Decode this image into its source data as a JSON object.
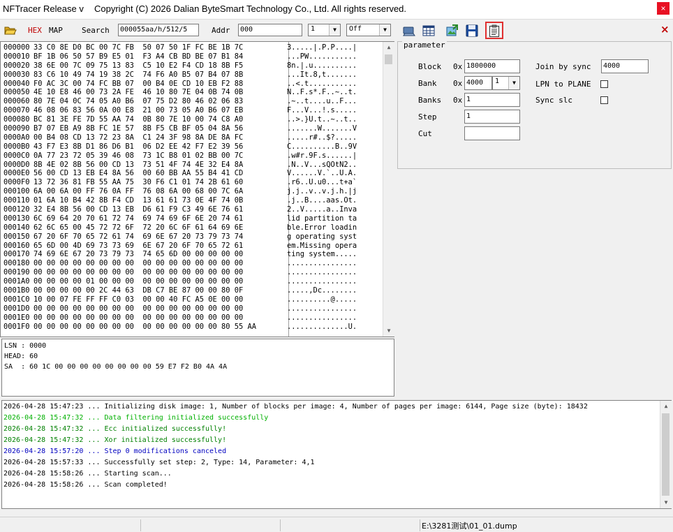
{
  "window": {
    "title": "NFTracer Release v",
    "copyright": "Copyright (C) 2026 Dalian ByteSmart Technology Co., Ltd. All rights reserved.",
    "close_label": "×"
  },
  "toolbar": {
    "hex_label": "HEX",
    "map_label": "MAP",
    "search_label": "Search",
    "search_value": "000055aa/h/512/5",
    "addr_label": "Addr",
    "addr_value": "000",
    "count_value": "1",
    "mode_value": "Off"
  },
  "hex_rows": [
    {
      "addr": "000000",
      "hex": "33 C0 8E D0 BC 00 7C FB  50 07 50 1F FC BE 1B 7C",
      "ascii": "3.....|.P.P....|"
    },
    {
      "addr": "000010",
      "hex": "BF 1B 06 50 57 B9 E5 01  F3 A4 CB BD BE 07 B1 84",
      "ascii": "...PW..........."
    },
    {
      "addr": "000020",
      "hex": "38 6E 00 7C 09 75 13 83  C5 10 E2 F4 CD 18 8B F5",
      "ascii": "8n.|.u.........."
    },
    {
      "addr": "000030",
      "hex": "83 C6 10 49 74 19 38 2C  74 F6 A0 B5 07 B4 07 8B",
      "ascii": "...It.8,t......."
    },
    {
      "addr": "000040",
      "hex": "F0 AC 3C 00 74 FC BB 07  00 B4 0E CD 10 EB F2 88",
      "ascii": "..<.t..........."
    },
    {
      "addr": "000050",
      "hex": "4E 10 E8 46 00 73 2A FE  46 10 80 7E 04 0B 74 0B",
      "ascii": "N..F.s*.F..~..t."
    },
    {
      "addr": "000060",
      "hex": "80 7E 04 0C 74 05 A0 B6  07 75 D2 80 46 02 06 83",
      "ascii": ".~..t....u..F..."
    },
    {
      "addr": "000070",
      "hex": "46 08 06 83 56 0A 00 E8  21 00 73 05 A0 B6 07 EB",
      "ascii": "F...V...!.s....."
    },
    {
      "addr": "000080",
      "hex": "BC 81 3E FE 7D 55 AA 74  0B 80 7E 10 00 74 C8 A0",
      "ascii": "..>.}U.t..~..t.."
    },
    {
      "addr": "000090",
      "hex": "B7 07 EB A9 8B FC 1E 57  8B F5 CB BF 05 04 8A 56",
      "ascii": ".......W.......V"
    },
    {
      "addr": "0000A0",
      "hex": "00 B4 08 CD 13 72 23 8A  C1 24 3F 98 8A DE 8A FC",
      "ascii": ".....r#..$?....."
    },
    {
      "addr": "0000B0",
      "hex": "43 F7 E3 8B D1 86 D6 B1  06 D2 EE 42 F7 E2 39 56",
      "ascii": "C..........B..9V"
    },
    {
      "addr": "0000C0",
      "hex": "0A 77 23 72 05 39 46 08  73 1C B8 01 02 BB 00 7C",
      "ascii": ".w#r.9F.s......|"
    },
    {
      "addr": "0000D0",
      "hex": "8B 4E 02 8B 56 00 CD 13  73 51 4F 74 4E 32 E4 8A",
      "ascii": ".N..V...sQOtN2.."
    },
    {
      "addr": "0000E0",
      "hex": "56 00 CD 13 EB E4 8A 56  00 60 BB AA 55 B4 41 CD",
      "ascii": "V......V.`..U.A."
    },
    {
      "addr": "0000F0",
      "hex": "13 72 36 81 FB 55 AA 75  30 F6 C1 01 74 2B 61 60",
      "ascii": ".r6..U.u0...t+a`"
    },
    {
      "addr": "000100",
      "hex": "6A 00 6A 00 FF 76 0A FF  76 08 6A 00 68 00 7C 6A",
      "ascii": "j.j..v..v.j.h.|j"
    },
    {
      "addr": "000110",
      "hex": "01 6A 10 B4 42 8B F4 CD  13 61 61 73 0E 4F 74 0B",
      "ascii": ".j..B....aas.Ot."
    },
    {
      "addr": "000120",
      "hex": "32 E4 8B 56 00 CD 13 EB  D6 61 F9 C3 49 6E 76 61",
      "ascii": "2..V.....a..Inva"
    },
    {
      "addr": "000130",
      "hex": "6C 69 64 20 70 61 72 74  69 74 69 6F 6E 20 74 61",
      "ascii": "lid partition ta"
    },
    {
      "addr": "000140",
      "hex": "62 6C 65 00 45 72 72 6F  72 20 6C 6F 61 64 69 6E",
      "ascii": "ble.Error loadin"
    },
    {
      "addr": "000150",
      "hex": "67 20 6F 70 65 72 61 74  69 6E 67 20 73 79 73 74",
      "ascii": "g operating syst"
    },
    {
      "addr": "000160",
      "hex": "65 6D 00 4D 69 73 73 69  6E 67 20 6F 70 65 72 61",
      "ascii": "em.Missing opera"
    },
    {
      "addr": "000170",
      "hex": "74 69 6E 67 20 73 79 73  74 65 6D 00 00 00 00 00",
      "ascii": "ting system....."
    },
    {
      "addr": "000180",
      "hex": "00 00 00 00 00 00 00 00  00 00 00 00 00 00 00 00",
      "ascii": "................"
    },
    {
      "addr": "000190",
      "hex": "00 00 00 00 00 00 00 00  00 00 00 00 00 00 00 00",
      "ascii": "................"
    },
    {
      "addr": "0001A0",
      "hex": "00 00 00 00 01 00 00 00  00 00 00 00 00 00 00 00",
      "ascii": "................"
    },
    {
      "addr": "0001B0",
      "hex": "00 00 00 00 00 2C 44 63  DB C7 BE 87 00 00 80 0F",
      "ascii": ".....,Dc........"
    },
    {
      "addr": "0001C0",
      "hex": "10 00 07 FE FF FF C0 03  00 00 40 FC A5 0E 00 00",
      "ascii": "..........@....."
    },
    {
      "addr": "0001D0",
      "hex": "00 00 00 00 00 00 00 00  00 00 00 00 00 00 00 00",
      "ascii": "................"
    },
    {
      "addr": "0001E0",
      "hex": "00 00 00 00 00 00 00 00  00 00 00 00 00 00 00 00",
      "ascii": "................"
    },
    {
      "addr": "0001F0",
      "hex": "00 00 00 00 00 00 00 00  00 00 00 00 00 00 80 55 AA",
      "ascii": "..............U."
    }
  ],
  "info": {
    "lsn": "LSN : 0000",
    "head": "HEAD: 60",
    "sa": "SA  : 60 1C 00 00 00 00 00 00 00 00 59 E7 F2 B0 4A 4A"
  },
  "param": {
    "group_label": "parameter",
    "block_label": "Block",
    "block_prefix": "0x",
    "block_value": "1800000",
    "bank_label": "Bank",
    "bank_prefix": "0x",
    "bank_value": "4000",
    "bank_combo": "1",
    "banks_label": "Banks",
    "banks_prefix": "0x",
    "banks_value": "1",
    "step_label": "Step",
    "step_value": "1",
    "cut_label": "Cut",
    "cut_value": "",
    "join_label": "Join by sync",
    "join_value": "4000",
    "lpn_label": "LPN to PLANE",
    "sync_label": "Sync slc"
  },
  "log": [
    {
      "text": "2026-04-28 15:47:23 ... Initializing disk image: 1, Number of blocks per image: 4, Number of pages per image: 6144, Page size (byte): 18432",
      "color": "#000000"
    },
    {
      "text": "2026-04-28 15:47:32 ... Data filtering initialized successfully",
      "color": "#00b000"
    },
    {
      "text": "2026-04-28 15:47:32 ... Ecc initialized successfully!",
      "color": "#008000"
    },
    {
      "text": "2026-04-28 15:47:32 ... Xor initialized successfully!",
      "color": "#008000"
    },
    {
      "text": "2026-04-28 15:57:20 ... Step 0 modifications canceled",
      "color": "#0000c0"
    },
    {
      "text": "2026-04-28 15:57:33 ... Successfully set step: 2, Type: 14, Parameter: 4,1",
      "color": "#000000"
    },
    {
      "text": "2026-04-28 15:58:26 ... Starting scan...",
      "color": "#000000"
    },
    {
      "text": "2026-04-28 15:58:26 ... Scan completed!",
      "color": "#000000"
    }
  ],
  "status": {
    "path": "E:\\3281测试\\01_01.dump"
  },
  "colors": {
    "hex_label": "#c00000",
    "close_x": "#c00000",
    "highlight_border": "#e03030"
  }
}
